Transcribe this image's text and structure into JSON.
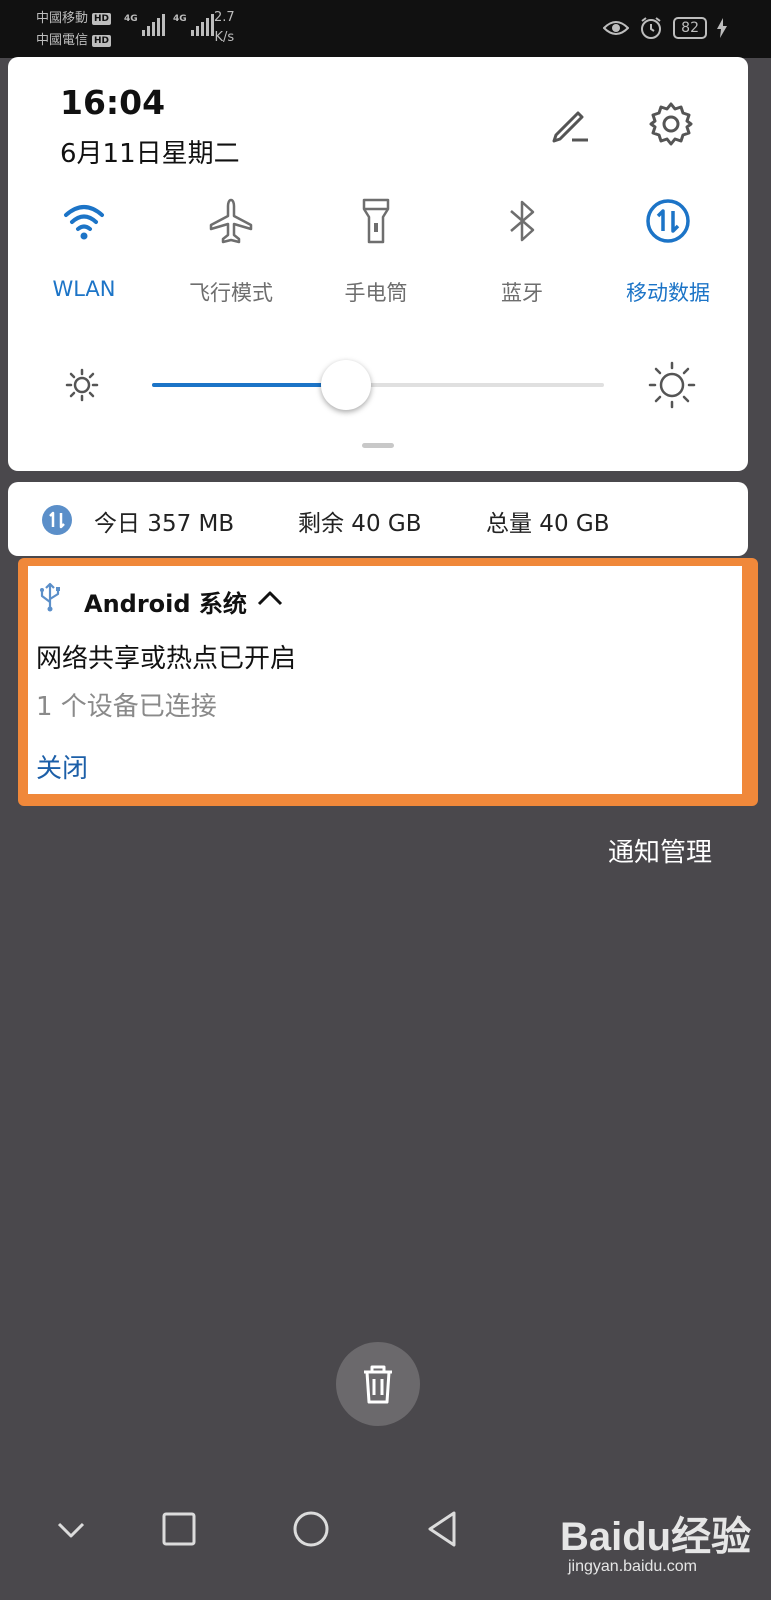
{
  "status_bar": {
    "carrier_1": "中國移動",
    "carrier_2": "中國電信",
    "hd_badge": "HD",
    "network_badge": "4G",
    "speed_value": "2.7",
    "speed_unit": "K/s",
    "battery": "82",
    "icons": [
      "eye-comfort-icon",
      "alarm-icon",
      "battery-icon",
      "charging-icon"
    ]
  },
  "quick_settings": {
    "time": "16:04",
    "date": "6月11日星期二",
    "tiles": [
      {
        "label": "WLAN",
        "icon": "wifi-icon",
        "active": true
      },
      {
        "label": "飞行模式",
        "icon": "airplane-icon",
        "active": false
      },
      {
        "label": "手电筒",
        "icon": "flashlight-icon",
        "active": false
      },
      {
        "label": "蓝牙",
        "icon": "bluetooth-icon",
        "active": false
      },
      {
        "label": "移动数据",
        "icon": "mobile-data-icon",
        "active": true
      }
    ],
    "brightness_level": 0.43,
    "accent_color": "#1c74c7"
  },
  "data_usage": {
    "today": "今日 357 MB",
    "remaining": "剩余 40 GB",
    "total": "总量 40 GB"
  },
  "notification": {
    "app_name": "Android 系统",
    "title": "网络共享或热点已开启",
    "text": "1 个设备已连接",
    "action": "关闭",
    "highlight_color": "#f0883a"
  },
  "manage_link": "通知管理",
  "watermark": {
    "logo": "Baidu经验",
    "url": "jingyan.baidu.com"
  }
}
